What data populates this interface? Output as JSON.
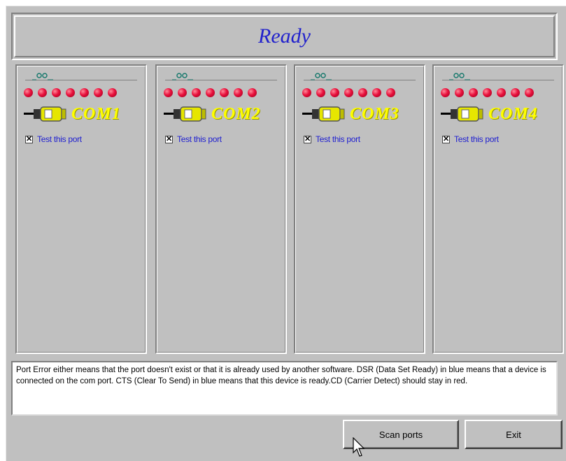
{
  "status": {
    "text": "Ready"
  },
  "ports": [
    {
      "name": "COM1",
      "test_label": "Test this port",
      "test_checked": true,
      "leds": 7
    },
    {
      "name": "COM2",
      "test_label": "Test this port",
      "test_checked": true,
      "leds": 7
    },
    {
      "name": "COM3",
      "test_label": "Test this port",
      "test_checked": true,
      "leds": 7
    },
    {
      "name": "COM4",
      "test_label": "Test this port",
      "test_checked": true,
      "leds": 7
    }
  ],
  "info": {
    "text": "Port Error either means that the port doesn't exist or that it is already used by another software. DSR (Data Set Ready) in blue means that a device is connected on the com port. CTS (Clear To Send) in blue means that this device is ready.CD (Carrier Detect) should stay in red."
  },
  "buttons": {
    "scan": "Scan ports",
    "exit": "Exit"
  },
  "colors": {
    "background": "#c0c0c0",
    "status_text": "#2222cc",
    "led_off": "#e8103c",
    "port_name": "#ffff00",
    "link_text": "#2020d0"
  },
  "icons": {
    "led": "red-led-icon",
    "connector": "serial-connector-icon",
    "group": "led-group-icon"
  }
}
